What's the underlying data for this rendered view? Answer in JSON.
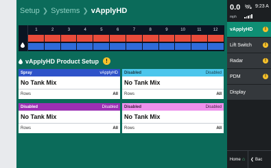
{
  "breadcrumb": {
    "items": [
      "Setup",
      "Systems"
    ],
    "current": "vApplyHD"
  },
  "row_grid": {
    "columns": [
      "1",
      "2",
      "3",
      "4",
      "5",
      "6",
      "7",
      "8",
      "9",
      "10",
      "11",
      "12"
    ],
    "rows": [
      "red",
      "blue"
    ],
    "row_colors": {
      "red": "#e84b3a",
      "blue": "#2f6bd9"
    }
  },
  "product_setup": {
    "title": "vApplyHD Product Setup",
    "cards": [
      {
        "label": "Spray",
        "name": "vApplyHD",
        "mix": "No Tank Mix",
        "rows_label": "Rows",
        "rows_value": "All",
        "color": "#2f53c9"
      },
      {
        "label": "Disabled",
        "name": "Disabled",
        "mix": "No Tank Mix",
        "rows_label": "Rows",
        "rows_value": "All",
        "color": "#4cc6ec"
      },
      {
        "label": "Disabled",
        "name": "Disabled",
        "mix": "No Tank Mix",
        "rows_label": "Rows",
        "rows_value": "All",
        "color": "#9c2fb4"
      },
      {
        "label": "Disabled",
        "name": "Disabled",
        "mix": "No Tank Mix",
        "rows_label": "Rows",
        "rows_value": "All",
        "color": "#ee90ec"
      }
    ]
  },
  "status": {
    "speed": "0.0",
    "speed_unit": "mph",
    "clock": "9:23 A"
  },
  "nav": {
    "items": [
      {
        "label": "vApplyHD",
        "warning": true,
        "active": true
      },
      {
        "label": "Lift Switch",
        "warning": true,
        "active": false
      },
      {
        "label": "Radar",
        "warning": true,
        "active": false
      },
      {
        "label": "PDM",
        "warning": true,
        "active": false
      },
      {
        "label": "Display",
        "warning": false,
        "active": false
      }
    ],
    "home_label": "Home",
    "back_label": "Bac"
  },
  "colors": {
    "main_bg": "#0b6b5a",
    "accent": "#0f8f74",
    "warning": "#f6c12b",
    "panel": "#1c1f22"
  }
}
